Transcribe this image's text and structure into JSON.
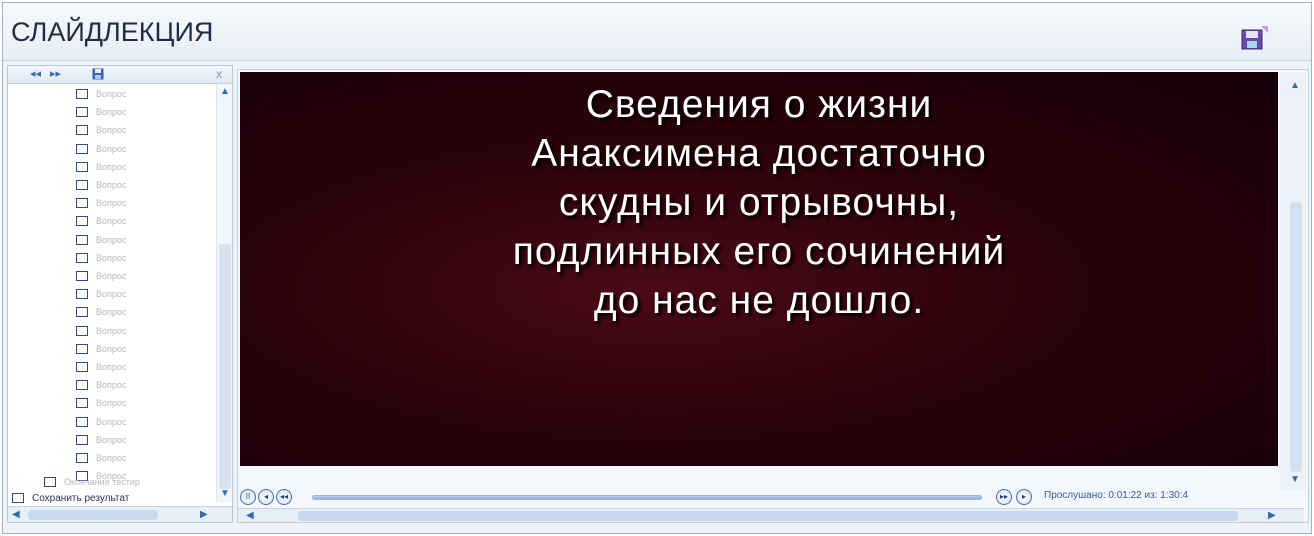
{
  "app": {
    "title": "СЛАЙДЛЕКЦИЯ",
    "save_icon": "save-icon"
  },
  "sidebar": {
    "toolbar": {
      "back_icon": "arrow-left-icon",
      "forward_icon": "arrow-right-icon",
      "save_icon": "save-icon",
      "close_label": "x"
    },
    "items": [
      {
        "label": "Вопрос"
      },
      {
        "label": "Вопрос"
      },
      {
        "label": "Вопрос"
      },
      {
        "label": "Вопрос"
      },
      {
        "label": "Вопрос"
      },
      {
        "label": "Вопрос"
      },
      {
        "label": "Вопрос"
      },
      {
        "label": "Вопрос"
      },
      {
        "label": "Вопрос"
      },
      {
        "label": "Вопрос"
      },
      {
        "label": "Вопрос"
      },
      {
        "label": "Вопрос"
      },
      {
        "label": "Вопрос"
      },
      {
        "label": "Вопрос"
      },
      {
        "label": "Вопрос"
      },
      {
        "label": "Вопрос"
      },
      {
        "label": "Вопрос"
      },
      {
        "label": "Вопрос"
      },
      {
        "label": "Вопрос"
      },
      {
        "label": "Вопрос"
      },
      {
        "label": "Вопрос"
      },
      {
        "label": "Вопрос"
      }
    ],
    "end_item": "Окончание тестир",
    "save_results": "Сохранить результат"
  },
  "slide": {
    "lines": [
      "Сведения о жизни",
      "Анаксимена достаточно",
      "скудны и отрывочны,",
      "подлинных его сочинений",
      "до нас не дошло."
    ]
  },
  "player": {
    "pause_label": "II",
    "prev_label": "◂",
    "rewind_label": "◂◂",
    "fwd_label": "▸▸",
    "next_label": "▸",
    "played_text": "Прослушано: 0:01:22 из: 1:30:4"
  },
  "colors": {
    "accent": "#3566b0",
    "slide_bg": "#2b0209",
    "slide_text": "#ffffff"
  }
}
